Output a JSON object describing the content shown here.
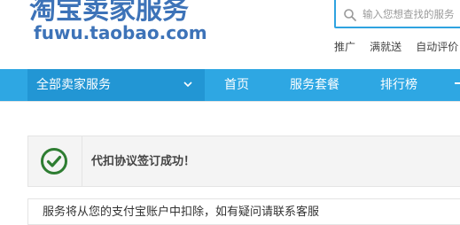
{
  "header": {
    "logo_cn": "淘宝卖家服务",
    "logo_en": "fuwu.taobao.com",
    "search": {
      "placeholder": "输入您想查找的服务"
    },
    "hot_links": [
      "推广",
      "满就送",
      "自动评价"
    ]
  },
  "nav": {
    "all_services": "全部卖家服务",
    "items": [
      "首页",
      "服务套餐",
      "排行榜"
    ]
  },
  "notice": {
    "text": "代扣协议签订成功！"
  },
  "next_section": {
    "text": "服务将从您的支付宝账户中扣除，如有疑问请联系客服"
  },
  "colors": {
    "brand_blue": "#3d73b8",
    "nav_blue": "#2ea7e3",
    "nav_active": "#2296d4",
    "success_green": "#2e7d32"
  }
}
